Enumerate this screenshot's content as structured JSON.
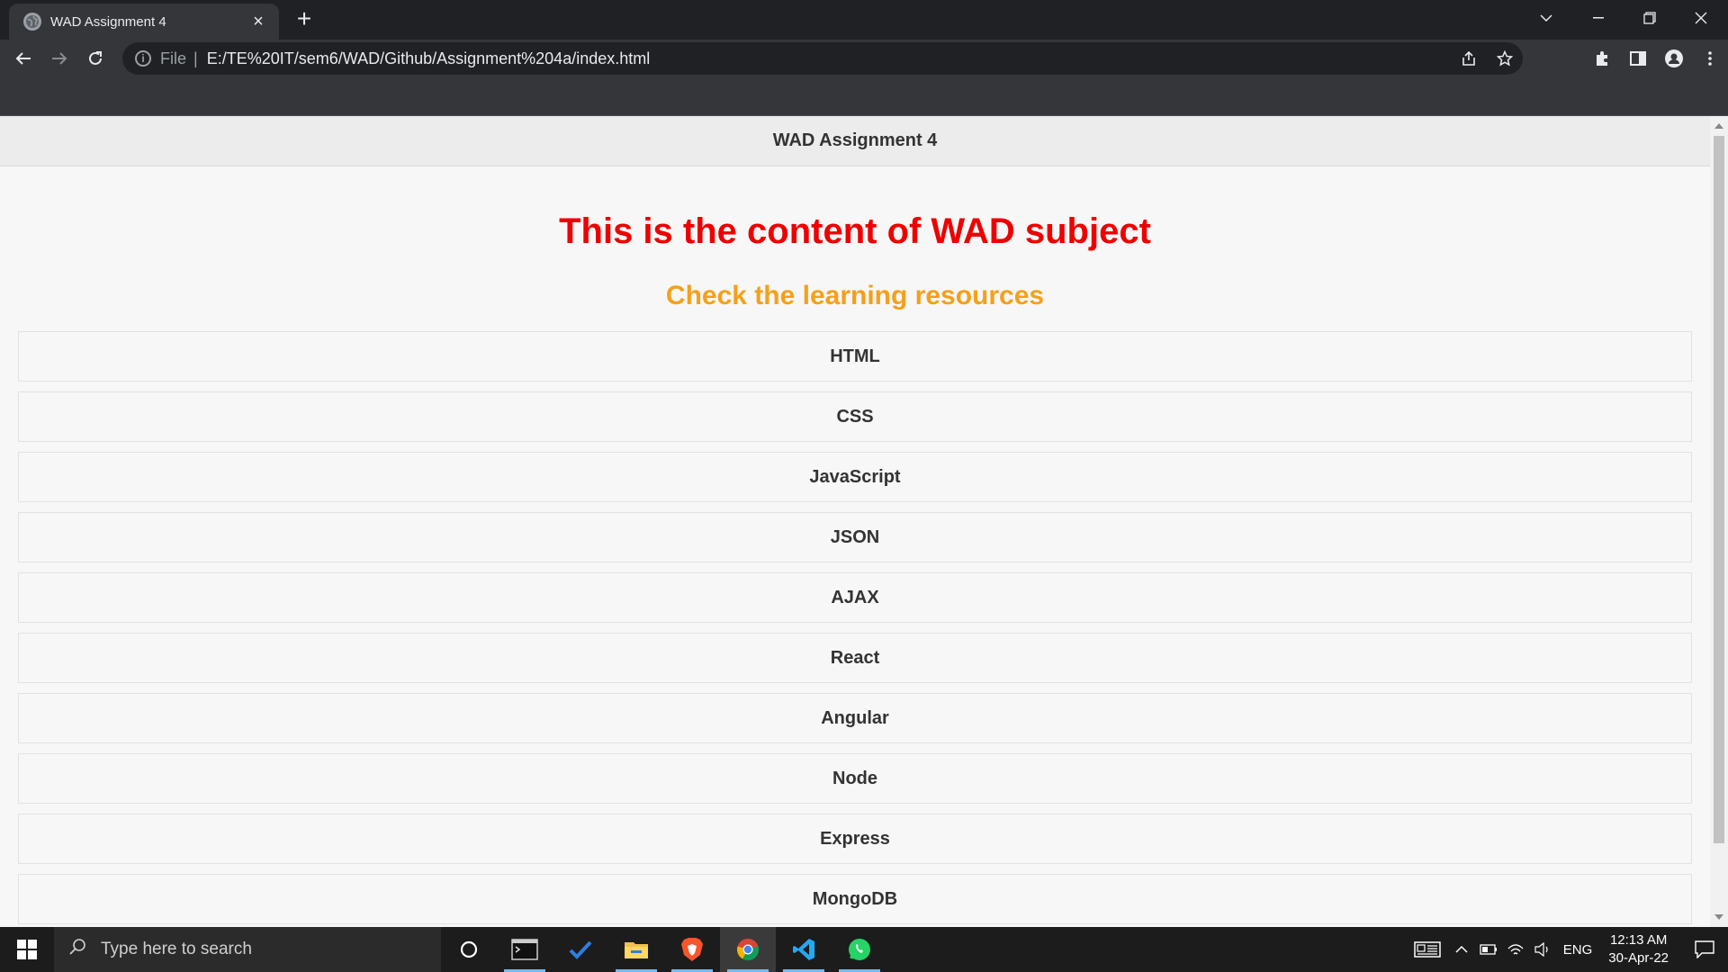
{
  "browser": {
    "tab_title": "WAD Assignment 4",
    "new_tab_symbol": "+",
    "url_scheme": "File",
    "url_path": "E:/TE%20IT/sem6/WAD/Github/Assignment%204a/index.html"
  },
  "page": {
    "header_title": "WAD Assignment 4",
    "heading": "This is the content of WAD subject",
    "subheading": "Check the learning resources",
    "resources": [
      {
        "label": "HTML"
      },
      {
        "label": "CSS"
      },
      {
        "label": "JavaScript"
      },
      {
        "label": "JSON"
      },
      {
        "label": "AJAX"
      },
      {
        "label": "React"
      },
      {
        "label": "Angular"
      },
      {
        "label": "Node"
      },
      {
        "label": "Express"
      },
      {
        "label": "MongoDB"
      }
    ],
    "colors": {
      "heading": "#ee0000",
      "subheading": "#f5a01a"
    }
  },
  "taskbar": {
    "search_placeholder": "Type here to search",
    "language": "ENG",
    "time": "12:13 AM",
    "date": "30-Apr-22",
    "pinned_icons": [
      "cortana-icon",
      "terminal-icon",
      "todo-icon",
      "file-explorer-icon",
      "brave-icon",
      "chrome-icon",
      "vscode-icon",
      "whatsapp-icon"
    ]
  }
}
